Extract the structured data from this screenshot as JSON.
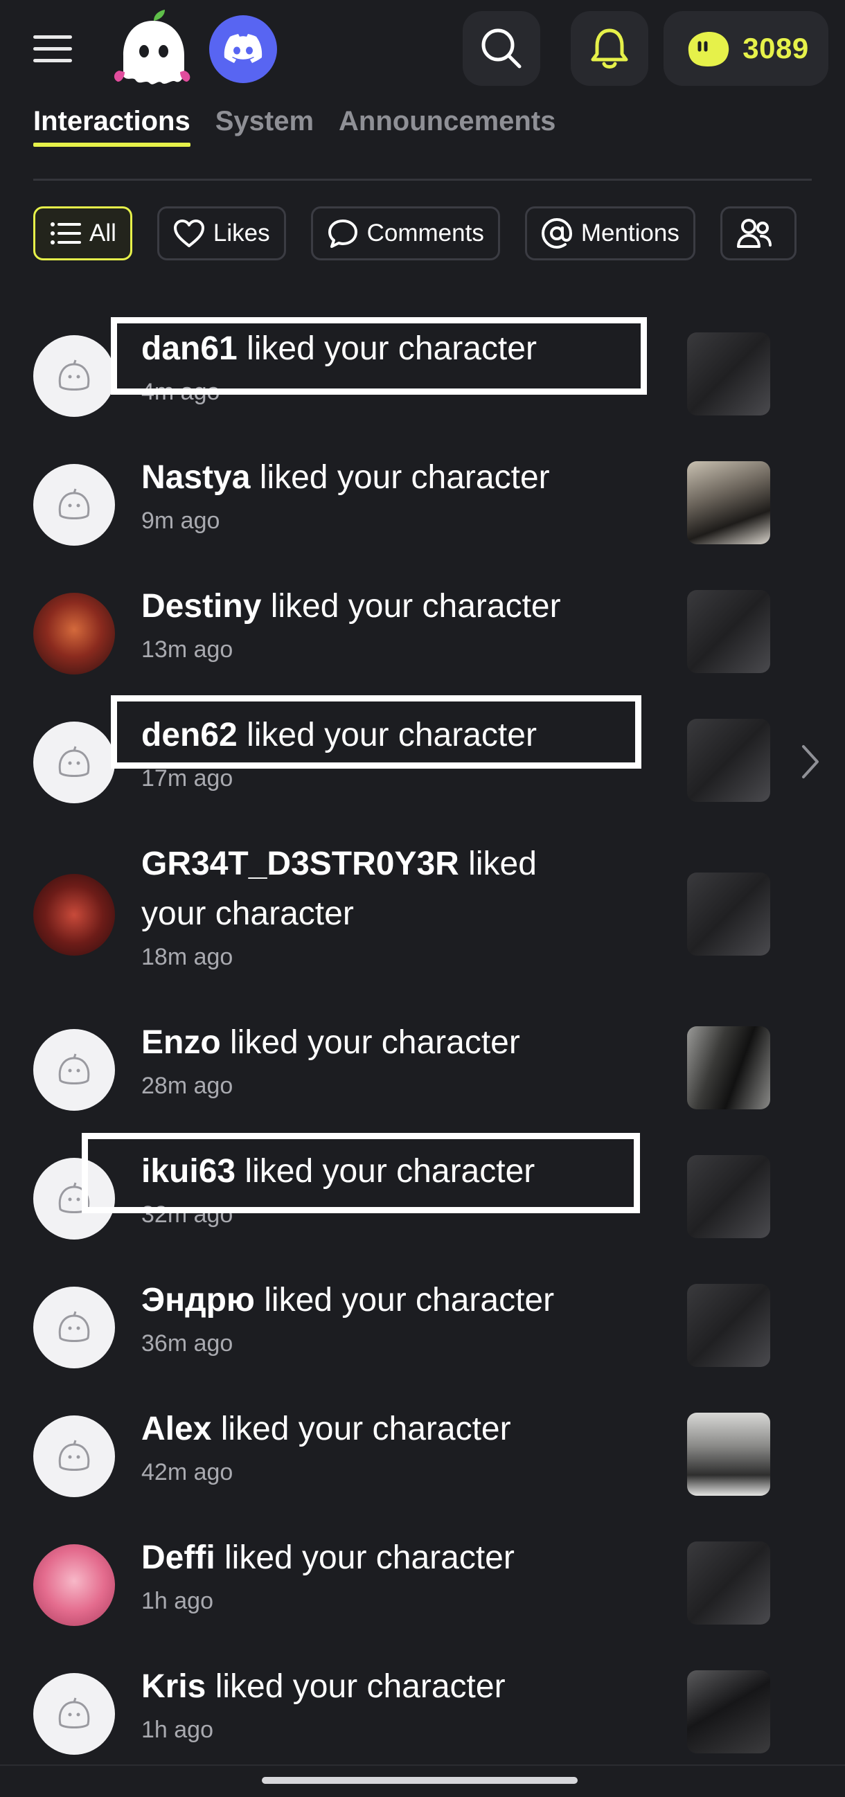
{
  "header": {
    "menu_icon": "hamburger-menu-icon",
    "logo_icon": "ghost-logo-icon",
    "discord_icon": "discord-icon",
    "search_icon": "search-icon",
    "bell_icon": "bell-icon",
    "coins": "3089"
  },
  "tabs": [
    {
      "label": "Interactions",
      "active": true
    },
    {
      "label": "System",
      "active": false
    },
    {
      "label": "Announcements",
      "active": false
    }
  ],
  "filters": [
    {
      "label": "All",
      "icon": "list-icon",
      "active": true
    },
    {
      "label": "Likes",
      "icon": "heart-icon",
      "active": false
    },
    {
      "label": "Comments",
      "icon": "comment-icon",
      "active": false
    },
    {
      "label": "Mentions",
      "icon": "at-icon",
      "active": false
    },
    {
      "label": "",
      "icon": "users-icon",
      "active": false
    }
  ],
  "notifications": [
    {
      "user": "dan61",
      "action": " liked your character",
      "time": "4m ago"
    },
    {
      "user": "Nastya",
      "action": " liked your character",
      "time": "9m ago"
    },
    {
      "user": "Destiny",
      "action": " liked your character",
      "time": "13m ago"
    },
    {
      "user": "den62",
      "action": " liked your character",
      "time": "17m ago"
    },
    {
      "user": "GR34T_D3STR0Y3R",
      "action": " liked your character",
      "time": "18m ago"
    },
    {
      "user": "Enzo",
      "action": " liked your character",
      "time": "28m ago"
    },
    {
      "user": "ikui63",
      "action": " liked your character",
      "time": "32m ago"
    },
    {
      "user": "Эндрю",
      "action": " liked your character",
      "time": "36m ago"
    },
    {
      "user": "Alex",
      "action": " liked your character",
      "time": "42m ago"
    },
    {
      "user": "Deffi ",
      "action": " liked your character",
      "time": "1h ago"
    },
    {
      "user": "Kris",
      "action": " liked your character",
      "time": "1h ago"
    }
  ],
  "colors": {
    "background": "#1c1d21",
    "accent": "#e6f14a",
    "discord": "#5865f2",
    "muted_text": "#a9aab0"
  }
}
